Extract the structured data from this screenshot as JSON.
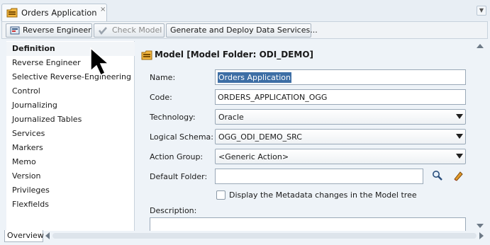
{
  "tab": {
    "title": "Orders Application",
    "close": "×"
  },
  "toolbar": {
    "reverse_engineer": "Reverse Engineer",
    "check_model": "Check Model",
    "generate_deploy": "Generate and Deploy Data Services..."
  },
  "nav": {
    "items": [
      {
        "label": "Definition"
      },
      {
        "label": "Reverse Engineer"
      },
      {
        "label": "Selective Reverse-Engineering"
      },
      {
        "label": "Control"
      },
      {
        "label": "Journalizing"
      },
      {
        "label": "Journalized Tables"
      },
      {
        "label": "Services"
      },
      {
        "label": "Markers"
      },
      {
        "label": "Memo"
      },
      {
        "label": "Version"
      },
      {
        "label": "Privileges"
      },
      {
        "label": "Flexfields"
      }
    ],
    "selected": "Definition"
  },
  "model_header": "Model [Model Folder: ODI_DEMO]",
  "form": {
    "name_label": "Name:",
    "name_value": "Orders Application",
    "code_label": "Code:",
    "code_value": "ORDERS_APPLICATION_OGG",
    "technology_label": "Technology:",
    "technology_value": "Oracle",
    "logical_schema_label": "Logical Schema:",
    "logical_schema_value": "OGG_ODI_DEMO_SRC",
    "action_group_label": "Action Group:",
    "action_group_value": "<Generic Action>",
    "default_folder_label": "Default Folder:",
    "default_folder_value": "",
    "display_metadata_label": "Display the Metadata changes in the Model tree",
    "display_metadata_checked": false,
    "description_label": "Description:"
  },
  "bottom_tabs": {
    "overview": "Overview"
  },
  "colors": {
    "selection": "#3d6ea5",
    "background": "#eef3f8",
    "folder_icon": "#e8a317"
  },
  "icons": [
    "model-folder-icon",
    "reverse-engineer-icon",
    "check-model-icon",
    "search-icon",
    "eraser-icon",
    "close-icon",
    "chevron-down-icon",
    "mouse-cursor-icon"
  ]
}
